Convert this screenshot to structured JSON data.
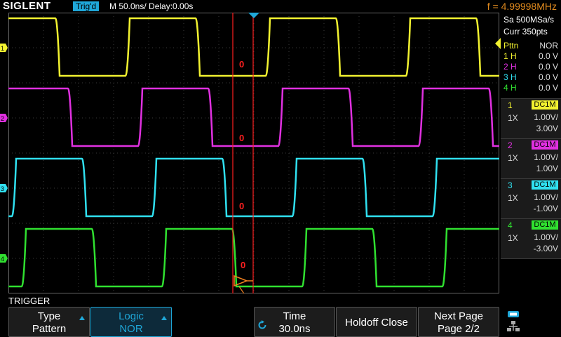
{
  "header": {
    "logo": "SIGLENT",
    "trig_status": "Trig'd",
    "timebase": "M 50.0ns/  Delay:0.00s",
    "frequency": "f = 4.99998MHz"
  },
  "acquisition": {
    "sample_rate": "Sa 500MSa/s",
    "memory": "Curr 350pts"
  },
  "pattern_table": {
    "header_left": "Pttn",
    "header_right": "NOR",
    "rows": [
      {
        "label": "1 H",
        "value": "0.0 V",
        "color": "#f2f230"
      },
      {
        "label": "2 H",
        "value": "0.0 V",
        "color": "#e030e0"
      },
      {
        "label": "3 H",
        "value": "0.0 V",
        "color": "#30e0f0"
      },
      {
        "label": "4 H",
        "value": "0.0 V",
        "color": "#30e030"
      }
    ]
  },
  "channels": [
    {
      "num": "1",
      "coupling": "DC1M",
      "probe": "1X",
      "scale": "1.00V/",
      "offset": "3.00V",
      "color": "#f2f230"
    },
    {
      "num": "2",
      "coupling": "DC1M",
      "probe": "1X",
      "scale": "1.00V/",
      "offset": "1.00V",
      "color": "#e030e0"
    },
    {
      "num": "3",
      "coupling": "DC1M",
      "probe": "1X",
      "scale": "1.00V/",
      "offset": "-1.00V",
      "color": "#30e0f0"
    },
    {
      "num": "4",
      "coupling": "DC1M",
      "probe": "1X",
      "scale": "1.00V/",
      "offset": "-3.00V",
      "color": "#30e030"
    }
  ],
  "trace_labels": {
    "ch1": "1",
    "ch2": "2",
    "ch3": "3",
    "ch4": "4"
  },
  "cursor_labels": {
    "c1": "0",
    "c2": "0",
    "c3": "0",
    "c4": "0"
  },
  "trigger_menu": {
    "title": "TRIGGER",
    "type_label": "Type",
    "type_value": "Pattern",
    "logic_label": "Logic",
    "logic_value": "NOR",
    "time_label": "Time",
    "time_value": "30.0ns",
    "holdoff_label": "Holdoff Close",
    "next_label": "Next Page",
    "next_value": "Page 2/2"
  },
  "colors": {
    "accent": "#1fa7d8",
    "frequency": "#e08a1e",
    "cursor": "#ff2020"
  },
  "icons": {
    "knob": "rotary-knob-icon",
    "usb": "usb-network-icon"
  }
}
